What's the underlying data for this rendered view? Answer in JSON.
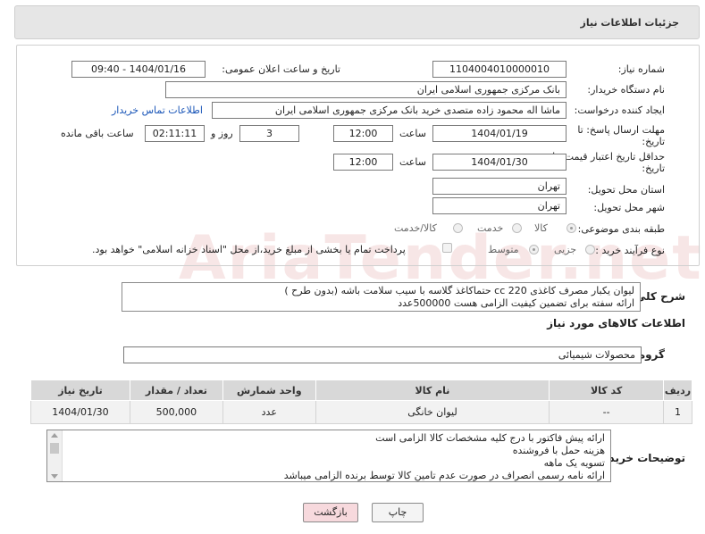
{
  "header": {
    "title": "جزئیات اطلاعات نیاز"
  },
  "form": {
    "need_number_label": "شماره نیاز:",
    "need_number": "1104004010000010",
    "announce_label": "تاریخ و ساعت اعلان عمومی:",
    "announce_value": "1404/01/16 - 09:40",
    "buyer_label": "نام دستگاه خریدار:",
    "buyer_value": "بانک مرکزی جمهوری اسلامی ایران",
    "creator_label": "ایجاد کننده درخواست:",
    "creator_value": "ماشا اله محمود زاده متصدی خرید بانک مرکزی جمهوری اسلامی ایران",
    "contact_link": "اطلاعات تماس خریدار",
    "deadline_label": "مهلت ارسال پاسخ: تا",
    "deadline_label2": "تاریخ:",
    "deadline_date": "1404/01/19",
    "time_label": "ساعت",
    "deadline_time": "12:00",
    "days_value": "3",
    "days_label": "روز و",
    "remaining_time": "02:11:11",
    "remaining_label": "ساعت باقی مانده",
    "validity_label": "حداقل تاریخ اعتبار قیمت: تا",
    "validity_label2": "تاریخ:",
    "validity_date": "1404/01/30",
    "validity_time": "12:00",
    "province_label": "استان محل تحویل:",
    "province_value": "تهران",
    "city_label": "شهر محل تحویل:",
    "city_value": "تهران",
    "category_label": "طبقه بندی موضوعی:",
    "category_options": [
      "کالا",
      "خدمت",
      "کالا/خدمت"
    ],
    "process_label": "نوع فرآیند خرید :",
    "process_options": [
      "جزیی",
      "متوسط"
    ],
    "payment_note": "پرداخت تمام یا بخشی از مبلغ خرید،از محل \"اسناد خزانه اسلامی\" خواهد بود."
  },
  "summary": {
    "label": "شرح کلی نیاز:",
    "line1": "لیوان یکبار مصرف کاغذی  cc 220 حتماکاغذ گلاسه با سیب سلامت باشه (بدون طرح )",
    "line2": "ارائه سفته برای تضمین کیفیت الزامی هست 500000عدد"
  },
  "goods": {
    "section_title": "اطلاعات کالاهای مورد نیاز",
    "group_label": "گروه کالا:",
    "group_value": "محصولات شیمیائی",
    "columns": [
      "ردیف",
      "کد کالا",
      "نام کالا",
      "واحد شمارش",
      "تعداد / مقدار",
      "تاریخ نیاز"
    ],
    "rows": [
      {
        "row": "1",
        "code": "--",
        "name": "لیوان خانگی",
        "unit": "عدد",
        "qty": "500,000",
        "date": "1404/01/30"
      }
    ]
  },
  "buyer_notes": {
    "label": "توضیحات خریدار:",
    "lines": [
      "ارائه پیش فاکتور با درج کلیه مشخصات کالا الزامی است",
      "هزینه حمل با فروشنده",
      "تسویه یک ماهه",
      "ارائه نامه رسمی انصراف در صورت عدم تامین کالا توسط برنده الزامی میباشد"
    ]
  },
  "buttons": {
    "print": "چاپ",
    "back": "بازگشت"
  },
  "watermark": "AriaTender.net",
  "colors": {
    "link": "#1a56b8",
    "back_button": "#f7d9dd",
    "print_button": "#f4f4f4"
  }
}
